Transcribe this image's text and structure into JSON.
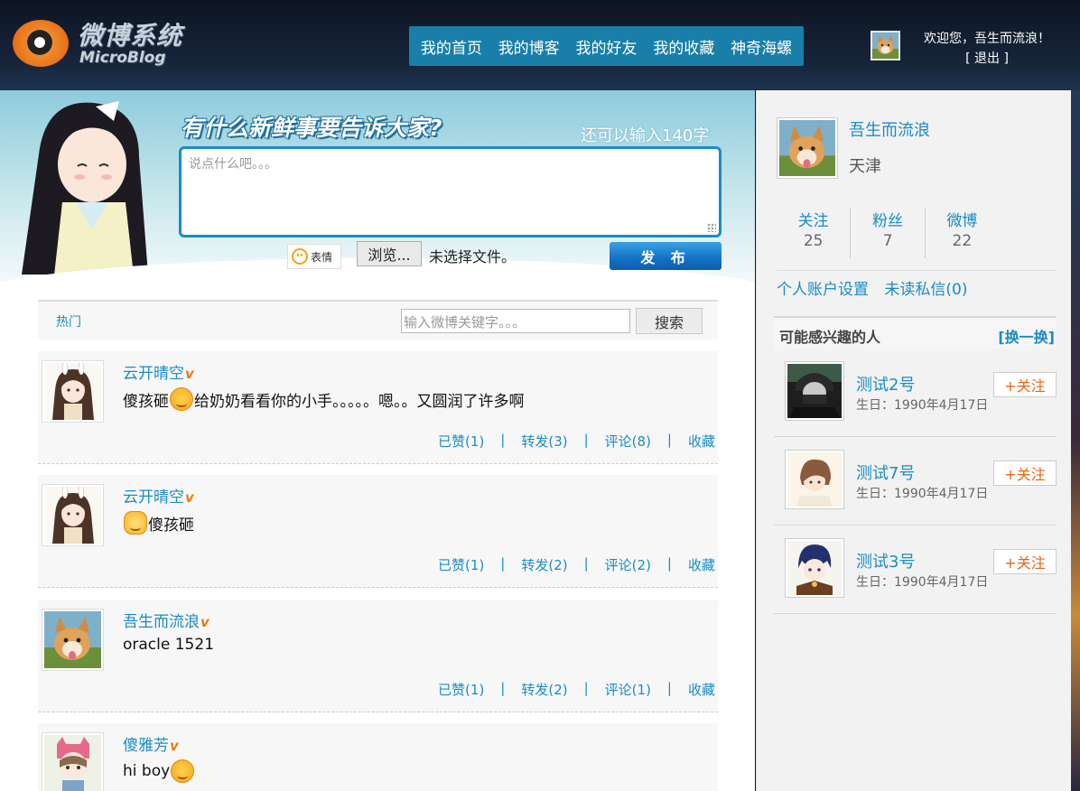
{
  "header": {
    "logo_title": "微博系统",
    "logo_subtitle": "MicroBlog",
    "nav": [
      "我的首页",
      "我的博客",
      "我的好友",
      "我的收藏",
      "神奇海螺"
    ],
    "welcome": "欢迎您，吾生而流浪！",
    "logout": "[ 退出 ]"
  },
  "composer": {
    "prompt": "有什么新鲜事要告诉大家?",
    "char_count": "还可以输入140字",
    "placeholder": "说点什么吧。。。",
    "emoji_label": "表情",
    "browse_label": "浏览...",
    "no_file": "未选择文件。",
    "publish_label": "发 布"
  },
  "filter": {
    "hot_tab": "热门",
    "search_placeholder": "输入微博关键字。。。",
    "search_button": "搜索"
  },
  "feed": [
    {
      "author": "云开晴空",
      "verified": "v",
      "content_before": "傻孩砸",
      "emoji": "smile",
      "content_after": "给奶奶看看你的小手。。。。。嗯。。又圆润了许多啊",
      "likes": "已赞(1)",
      "reposts": "转发(3)",
      "comments": "评论(8)",
      "favorite": "收藏"
    },
    {
      "author": "云开晴空",
      "verified": "v",
      "content_before": "",
      "emoji": "cat",
      "content_after": "傻孩砸",
      "likes": "已赞(1)",
      "reposts": "转发(2)",
      "comments": "评论(2)",
      "favorite": "收藏"
    },
    {
      "author": "吾生而流浪",
      "verified": "v",
      "content_before": "oracle 1521",
      "emoji": "",
      "content_after": "",
      "likes": "已赞(1)",
      "reposts": "转发(2)",
      "comments": "评论(1)",
      "favorite": "收藏"
    },
    {
      "author": "傻雅芳",
      "verified": "v",
      "content_before": "hi boy",
      "emoji": "smile",
      "content_after": "",
      "likes": "",
      "reposts": "",
      "comments": "",
      "favorite": ""
    }
  ],
  "profile": {
    "name": "吾生而流浪",
    "city": "天津",
    "stats": [
      {
        "label": "关注",
        "value": "25"
      },
      {
        "label": "粉丝",
        "value": "7"
      },
      {
        "label": "微博",
        "value": "22"
      }
    ],
    "account_settings": "个人账户设置",
    "unread_messages": "未读私信(0)"
  },
  "recommend": {
    "title": "可能感兴趣的人",
    "swap": "[换一换]",
    "people": [
      {
        "name": "测试2号",
        "birthday": "生日：1990年4月17日",
        "follow": "+关注"
      },
      {
        "name": "测试7号",
        "birthday": "生日：1990年4月17日",
        "follow": "+关注"
      },
      {
        "name": "测试3号",
        "birthday": "生日：1990年4月17日",
        "follow": "+关注"
      }
    ]
  },
  "colors": {
    "accent": "#1a8cc4",
    "nav_bg": "#1a7fa8",
    "follow": "#e8650f",
    "verified": "#e97b0c"
  }
}
